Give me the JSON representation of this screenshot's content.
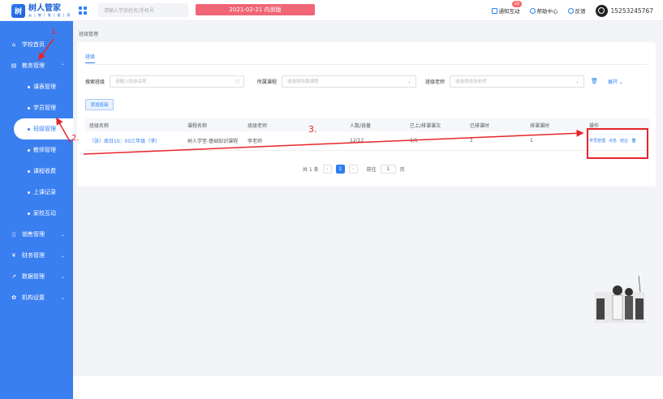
{
  "brand": {
    "title": "树人管家",
    "subtitle": "云 | 教 | 育 | 管 | 家"
  },
  "header": {
    "search_placeholder": "请输入学员姓名/手机号",
    "env_label": "2021-02-21 内测版",
    "notice_label": "通知互动",
    "notice_count": "10",
    "help_label": "帮助中心",
    "feedback_label": "反馈",
    "phone": "15253245767"
  },
  "sidebar": {
    "items": [
      {
        "icon": "home-icon",
        "label": "学校首页"
      },
      {
        "icon": "book-icon",
        "label": "教务管理"
      },
      {
        "icon": "file-icon",
        "label": "销售管理"
      },
      {
        "icon": "yen-icon",
        "label": "财务管理"
      },
      {
        "icon": "chart-icon",
        "label": "数据管理"
      },
      {
        "icon": "gear-icon",
        "label": "机构设置"
      }
    ],
    "sub_items": [
      "课表管理",
      "学员管理",
      "班级管理",
      "教师管理",
      "课程收费",
      "上课记录",
      "家校互动"
    ]
  },
  "breadcrumb": "班级管理",
  "tab": "班级",
  "filters": {
    "class_label": "搜索班级",
    "class_placeholder": "请输入班级名称",
    "course_label": "所属课程",
    "course_placeholder": "请选择所属课程",
    "teacher_label": "班级老师",
    "teacher_placeholder": "请选择班级老师",
    "expand_label": "展开"
  },
  "add_button": "添加班级",
  "table": {
    "headers": [
      "班级名称",
      "课程名称",
      "班级老师",
      "人数/容量",
      "已上/排课课次",
      "已排课时",
      "排课课时",
      "操作"
    ],
    "rows": [
      {
        "name": "（张）周日10：00三年级（李）",
        "course": "树人学堂-基础知识课程",
        "teacher": "李老师",
        "capacity": "12/12",
        "sessions": "1/1",
        "scheduled": "1",
        "hours": "1",
        "actions": [
          "学员管理",
          "点名",
          "结业"
        ]
      }
    ]
  },
  "pagination": {
    "total": "共 1 条",
    "current": "1",
    "goto_label": "前往",
    "goto_value": "1",
    "page_unit": "页"
  },
  "annotations": [
    "1.",
    "2.",
    "3."
  ],
  "colors": {
    "accent": "#2f7ef5",
    "sidebar": "#3a7ff0",
    "annotation": "#e8242b",
    "env_badge": "#f06677"
  }
}
